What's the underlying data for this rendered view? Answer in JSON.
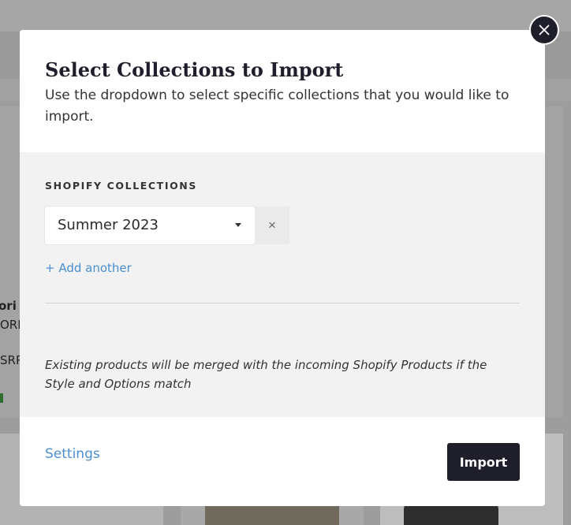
{
  "modal": {
    "title": "Select Collections to Import",
    "description": "Use the dropdown to select specific collections that you would like to import.",
    "section_label": "SHOPIFY COLLECTIONS",
    "selected_collection": "Summer 2023",
    "clear_symbol": "×",
    "add_another": "+ Add another",
    "note": "Existing products will be merged with the incoming Shopify Products if the Style and Options match",
    "settings_link": "Settings",
    "import_button": "Import"
  },
  "background": {
    "card_title_fragment": "ori H",
    "card_sku_fragment": "ORI-",
    "card_msrp_fragment": "SRP"
  },
  "icons": {
    "close": "close-icon",
    "dropdown": "chevron-down-icon"
  },
  "colors": {
    "accent": "#4b8fd1",
    "primary_dark": "#1f1f2b",
    "overlay_body": "#f2f2f2"
  }
}
